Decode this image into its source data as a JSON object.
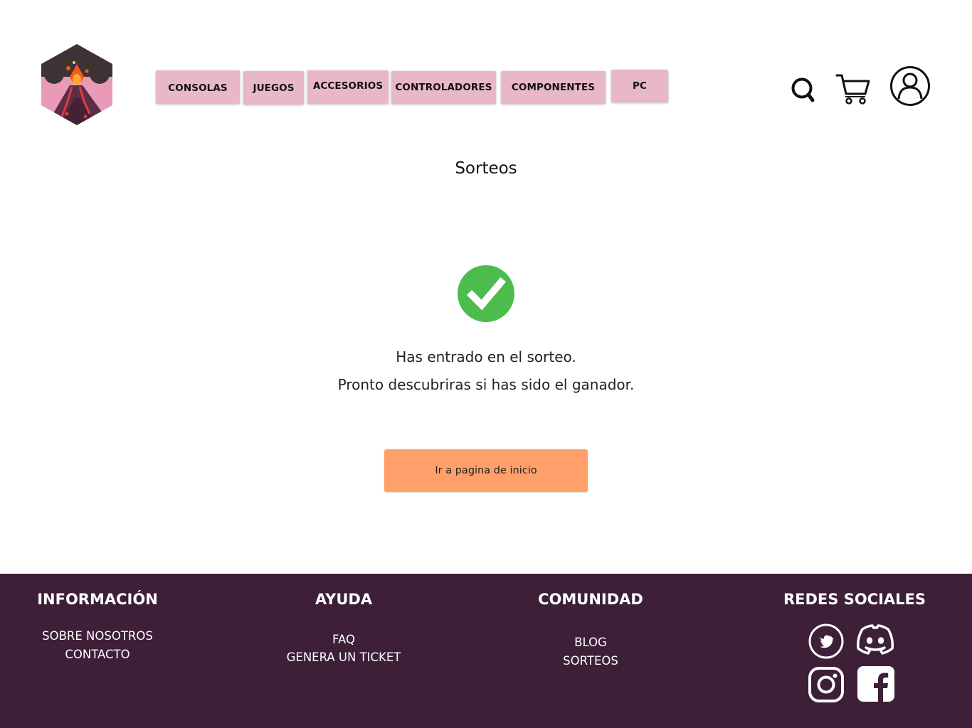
{
  "header": {
    "logo_icon": "volcano-hexagon-logo",
    "nav": [
      {
        "label": "CONSOLAS"
      },
      {
        "label": "JUEGOS"
      },
      {
        "label": "ACCESORIOS"
      },
      {
        "label": "CONTROLADORES"
      },
      {
        "label": "COMPONENTES"
      },
      {
        "label": "PC"
      }
    ],
    "icons": [
      "search-icon",
      "cart-icon",
      "user-account-icon"
    ],
    "nav_color": "#e8b7c8"
  },
  "main": {
    "title": "Sorteos",
    "status_icon": "check-circle-icon",
    "status_color": "#4cbc4c",
    "message_line1": "Has entrado en el sorteo.",
    "message_line2": "Pronto descubriras si has sido el ganador.",
    "home_button_label": "Ir a pagina de inicio",
    "button_color": "#ffa06b"
  },
  "footer": {
    "background": "#3d1f38",
    "info": {
      "heading": "INFORMACIÓN",
      "links": [
        "SOBRE NOSOTROS",
        "CONTACTO"
      ]
    },
    "help": {
      "heading": "AYUDA",
      "links": [
        "FAQ",
        "GENERA UN TICKET"
      ]
    },
    "community": {
      "heading": "COMUNIDAD",
      "links": [
        "BLOG",
        "SORTEOS"
      ]
    },
    "social": {
      "heading": "REDES SOCIALES",
      "icons": [
        "twitter-icon",
        "discord-icon",
        "instagram-icon",
        "facebook-icon"
      ]
    }
  }
}
